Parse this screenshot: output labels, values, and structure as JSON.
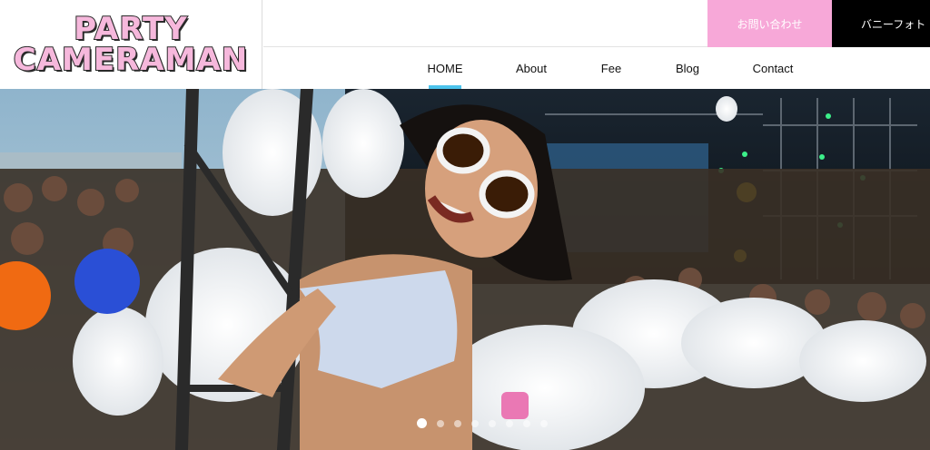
{
  "logo": {
    "line1": "PARTY",
    "line2": "CAMERAMAN"
  },
  "header": {
    "search_icon": "search-icon",
    "contact_label": "お問い合わせ",
    "banny_label": "バニーフォト"
  },
  "nav": {
    "items": [
      {
        "label": "HOME",
        "active": true
      },
      {
        "label": "About"
      },
      {
        "label": "Fee"
      },
      {
        "label": "Blog"
      },
      {
        "label": "Contact"
      }
    ]
  },
  "hero": {
    "slide_count": 8,
    "active_slide": 1
  },
  "colors": {
    "brand_pink": "#f7a8d8",
    "nav_accent": "#4cc3ec",
    "black": "#000000"
  }
}
